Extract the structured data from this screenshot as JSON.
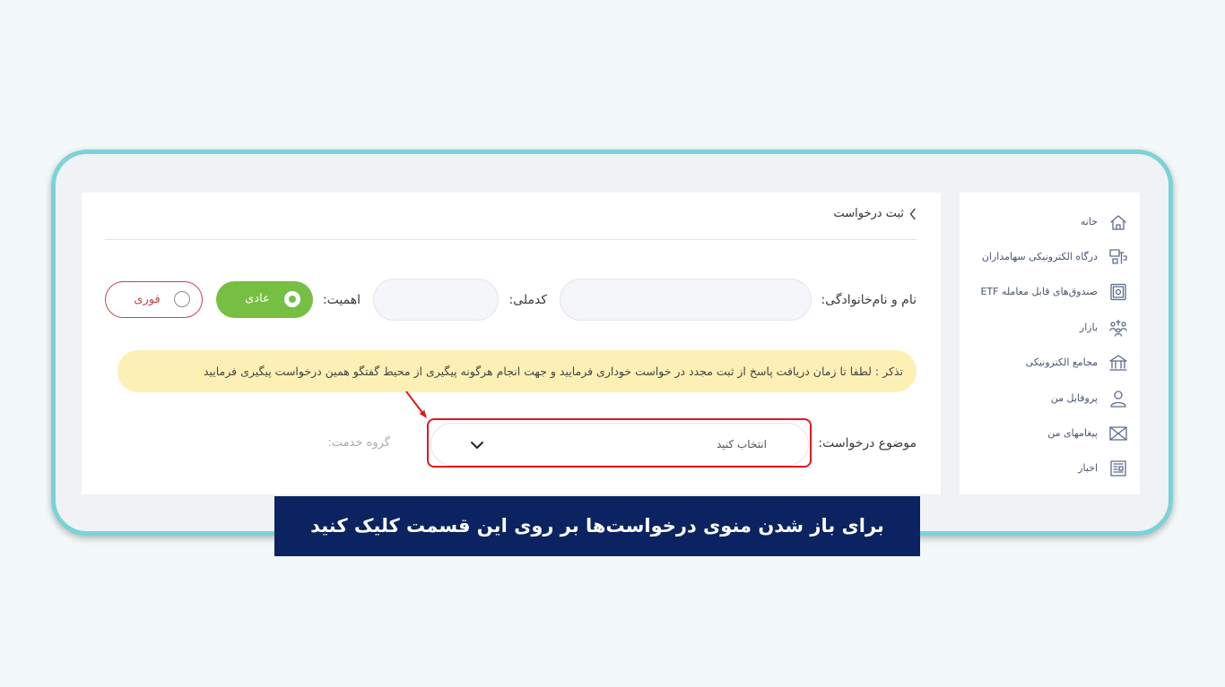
{
  "sidebar": {
    "items": [
      {
        "label": "خانه",
        "icon": "home-icon"
      },
      {
        "label": "درگاه الکترونیکی سهامداران",
        "icon": "shareholders-portal-icon"
      },
      {
        "label": "صندوق‌های قابل معامله ETF",
        "icon": "safe-icon"
      },
      {
        "label": "بازار",
        "icon": "market-icon"
      },
      {
        "label": "مجامع الکترونیکی",
        "icon": "assembly-icon"
      },
      {
        "label": "پروفایل من",
        "icon": "user-icon"
      },
      {
        "label": "پیغامهای من",
        "icon": "envelope-icon"
      },
      {
        "label": "اخبار",
        "icon": "newspaper-icon"
      }
    ]
  },
  "breadcrumb": {
    "title": "ثبت درخواست",
    "icon": "chevron-left-icon"
  },
  "form": {
    "name_label": "نام و نام‌خانوادگی:",
    "national_code_label": "کدملی:",
    "priority": {
      "label": "اهمیت:",
      "options": [
        {
          "label": "عادی",
          "selected": true
        },
        {
          "label": "فوری",
          "selected": false
        }
      ]
    },
    "notice": "تذکر : لطفا تا زمان دریافت پاسخ از ثبت مجدد در خواست خوداری فرمایید و جهت انجام هرگونه پیگیری از محیط گفتگو همین درخواست پیگیری فرمایید",
    "subject_label": "موضوع درخواست:",
    "subject_placeholder": "انتخاب کنید",
    "service_group_label": "گروه خدمت:"
  },
  "caption": {
    "text": "برای باز شدن منوی درخواست‌ها بر روی این قسمت کلیک کنید"
  },
  "colors": {
    "green": "#76bf43",
    "red": "#c8434f",
    "notice": "#fdf0b5",
    "caption": "#0b2361",
    "highlight": "#e0191f",
    "frame": "#7ad3d8",
    "icon": "#5d6b8a"
  }
}
